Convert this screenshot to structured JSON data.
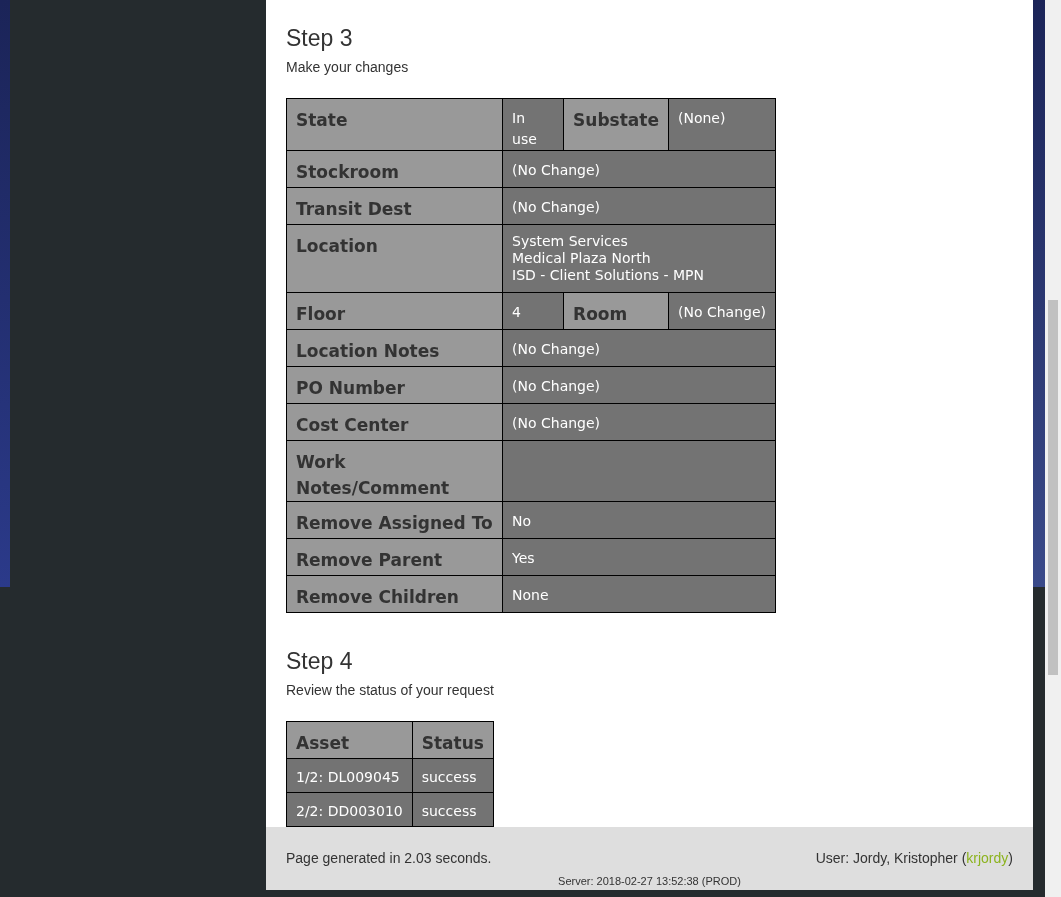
{
  "step3": {
    "title": "Step 3",
    "subtitle": "Make your changes",
    "rows": [
      {
        "kind": "split",
        "label": "State",
        "value": "In use",
        "label2": "Substate",
        "value2": "(None)"
      },
      {
        "kind": "single",
        "label": "Stockroom",
        "value": "(No Change)"
      },
      {
        "kind": "single",
        "label": "Transit Dest",
        "value": "(No Change)"
      },
      {
        "kind": "lines",
        "label": "Location",
        "lines": [
          "System Services",
          "Medical Plaza North",
          "ISD - Client Solutions - MPN"
        ]
      },
      {
        "kind": "split",
        "label": "Floor",
        "value": "4",
        "label2": "Room",
        "value2": "(No Change)"
      },
      {
        "kind": "single",
        "label": "Location Notes",
        "value": "(No Change)"
      },
      {
        "kind": "single",
        "label": "PO Number",
        "value": "(No Change)"
      },
      {
        "kind": "single",
        "label": "Cost Center",
        "value": "(No Change)"
      },
      {
        "kind": "empty",
        "label": "Work Notes/Comment"
      },
      {
        "kind": "single",
        "label": "Remove Assigned To",
        "value": "No"
      },
      {
        "kind": "single",
        "label": "Remove Parent",
        "value": "Yes"
      },
      {
        "kind": "single",
        "label": "Remove Children",
        "value": "None"
      }
    ]
  },
  "step4": {
    "title": "Step 4",
    "subtitle": "Review the status of your request",
    "columns": [
      "Asset",
      "Status"
    ],
    "rows": [
      [
        "1/2: DL009045",
        "success"
      ],
      [
        "2/2: DD003010",
        "success"
      ]
    ]
  },
  "footer": {
    "generated": "Page generated in 2.03 seconds.",
    "user_prefix": "User: Jordy, Kristopher (",
    "user_link": "krjordy",
    "user_suffix": ")",
    "server": "Server: 2018-02-27 13:52:38 (PROD)"
  }
}
